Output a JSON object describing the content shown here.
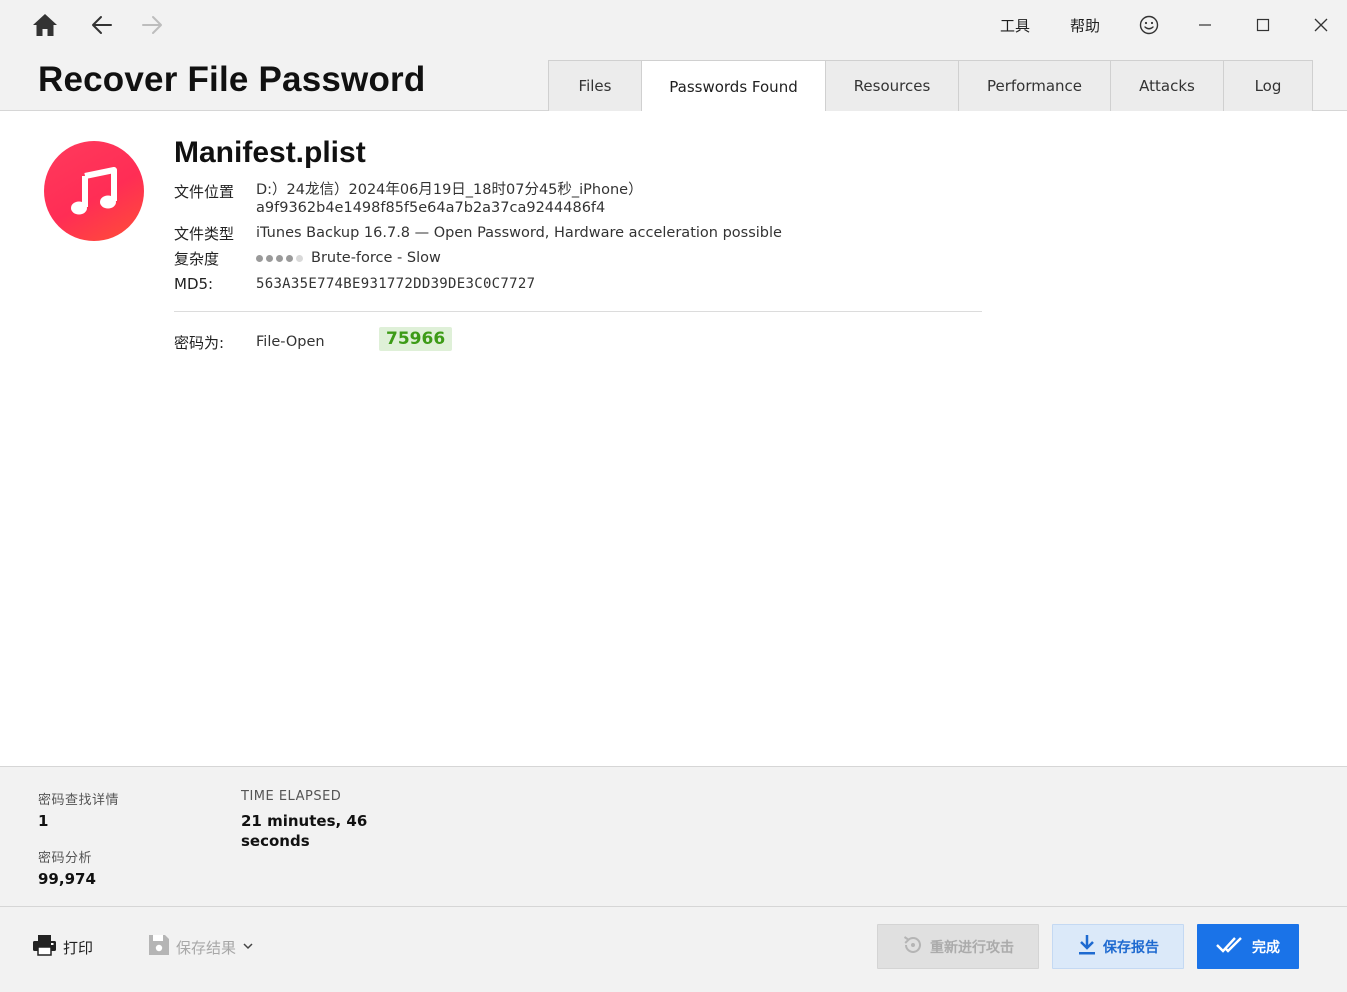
{
  "header": {
    "title": "Recover File Password",
    "menu": {
      "tools": "工具",
      "help": "帮助"
    },
    "nav_icons": [
      "home-icon",
      "back-arrow-icon",
      "forward-arrow-icon"
    ],
    "window_icons": [
      "smiley-icon",
      "minimize-icon",
      "maximize-icon",
      "close-icon"
    ]
  },
  "tabs": [
    {
      "label": "Files",
      "active": false
    },
    {
      "label": "Passwords Found",
      "active": true
    },
    {
      "label": "Resources",
      "active": false
    },
    {
      "label": "Performance",
      "active": false
    },
    {
      "label": "Attacks",
      "active": false
    },
    {
      "label": "Log",
      "active": false
    }
  ],
  "file": {
    "icon": "music-note-icon",
    "name": "Manifest.plist",
    "location_label": "文件位置",
    "location_line1": "D:）24龙信）2024年06月19日_18时07分45秒_iPhone）",
    "location_line2": "a9f9362b4e1498f85f5e64a7b2a37ca9244486f4",
    "type_label": "文件类型",
    "type_value": "iTunes Backup 16.7.8 — Open Password, Hardware acceleration possible",
    "complexity_label": "复杂度",
    "complexity_level": 4,
    "complexity_max": 5,
    "complexity_value": "Brute-force - Slow",
    "md5_label": "MD5:",
    "md5_value": "563A35E774BE931772DD39DE3C0C7727"
  },
  "password": {
    "label": "密码为:",
    "type": "File-Open",
    "value": "75966"
  },
  "stats": {
    "found_label": "密码查找详情",
    "found_value": "1",
    "analyzed_label": "密码分析",
    "analyzed_value": "99,974",
    "elapsed_label": "TIME ELAPSED",
    "elapsed_value_line1": "21 minutes, 46",
    "elapsed_value_line2": "seconds"
  },
  "footer": {
    "print_label": "打印",
    "save_results_label": "保存结果",
    "restart_label": "重新进行攻击",
    "report_label": "保存报告",
    "done_label": "完成"
  },
  "colors": {
    "accent": "#1a73e8",
    "password_bg": "#dff0d8",
    "password_text": "#3d9b17",
    "icon_gradient_start": "#ff3a5c",
    "icon_gradient_end": "#ff4f36"
  }
}
